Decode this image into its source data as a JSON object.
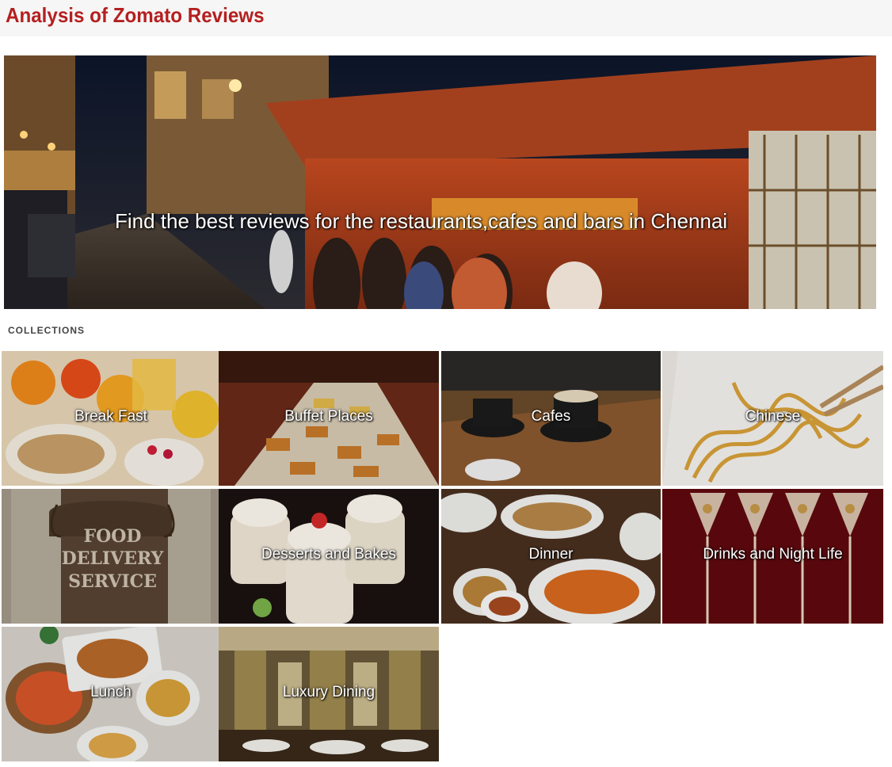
{
  "page": {
    "title": "Analysis of Zomato Reviews",
    "accent_color": "#b51f1f"
  },
  "hero": {
    "tagline": "Find the best reviews for the restaurants,cafes and bars in Chennai",
    "image": "night-street-food-market-photo"
  },
  "collections": {
    "heading": "COLLECTIONS",
    "items": [
      {
        "label": "Break Fast",
        "image": "breakfast-fruit-cereal-photo"
      },
      {
        "label": "Buffet Places",
        "image": "buffet-spread-photo"
      },
      {
        "label": "Cafes",
        "image": "coffee-cups-photo"
      },
      {
        "label": "Chinese",
        "image": "noodles-chopsticks-photo"
      },
      {
        "label": "",
        "image": "food-delivery-bag-photo",
        "image_text": "FOOD DELIVERY SERVICE"
      },
      {
        "label": "Desserts and Bakes",
        "image": "cupcake-desserts-photo"
      },
      {
        "label": "Dinner",
        "image": "dinner-plates-photo"
      },
      {
        "label": "Drinks and Night Life",
        "image": "cocktail-glasses-photo"
      },
      {
        "label": "Lunch",
        "image": "lunch-dishes-photo"
      },
      {
        "label": "Luxury Dining",
        "image": "luxury-dining-hall-photo"
      }
    ]
  }
}
